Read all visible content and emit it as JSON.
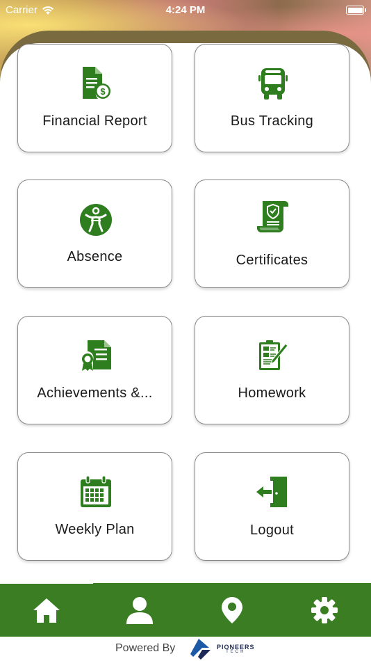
{
  "status_bar": {
    "carrier": "Carrier",
    "time": "4:24 PM",
    "wifi_icon": "wifi-icon",
    "battery_icon": "battery-icon"
  },
  "tiles": [
    {
      "label": "Financial Report",
      "icon": "financial-report-icon"
    },
    {
      "label": "Bus Tracking",
      "icon": "bus-icon"
    },
    {
      "label": "Absence",
      "icon": "absence-icon"
    },
    {
      "label": "Certificates",
      "icon": "certificate-icon"
    },
    {
      "label": "Achievements &...",
      "icon": "achievement-icon"
    },
    {
      "label": "Homework",
      "icon": "homework-icon"
    },
    {
      "label": "Weekly Plan",
      "icon": "calendar-icon"
    },
    {
      "label": "Logout",
      "icon": "logout-icon"
    }
  ],
  "bottom_nav": [
    {
      "icon": "home-icon",
      "active": true
    },
    {
      "icon": "profile-icon",
      "active": false
    },
    {
      "icon": "location-pin-icon",
      "active": false
    },
    {
      "icon": "settings-gear-icon",
      "active": false
    }
  ],
  "footer": {
    "powered_by": "Powered By",
    "brand_name": "PIONEERS",
    "brand_sub": "TECH"
  },
  "colors": {
    "accent_green": "#3a7d22",
    "icon_green": "#2e7d1f",
    "tile_border": "#8a8a8a",
    "brand_navy": "#1c2a55"
  }
}
